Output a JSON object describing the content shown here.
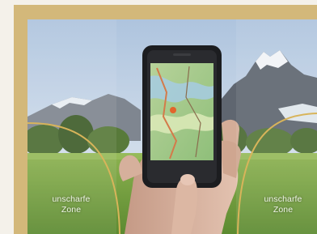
{
  "colors": {
    "frame": "#d3b87a",
    "zone_line": "#d8b45a",
    "sky_top": "#b9cbe0",
    "meadow": "#7fa94a"
  },
  "zones": {
    "left": {
      "line1": "unscharfe",
      "line2": "Zone"
    },
    "right": {
      "line1": "unscharfe",
      "line2": "Zone"
    }
  },
  "icons": [
    "smartphone",
    "hand",
    "map"
  ]
}
